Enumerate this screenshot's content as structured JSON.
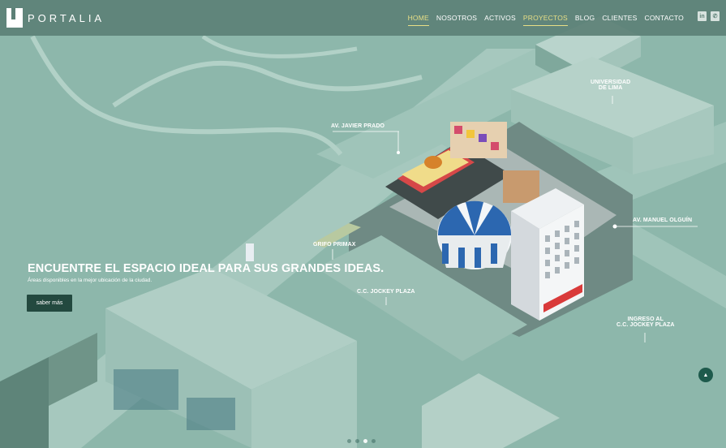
{
  "brand": {
    "name": "PORTALIA"
  },
  "nav": {
    "items": [
      {
        "label": "HOME",
        "state": "active"
      },
      {
        "label": "NOSOTROS",
        "state": ""
      },
      {
        "label": "ACTIVOS",
        "state": ""
      },
      {
        "label": "PROYECTOS",
        "state": "active"
      },
      {
        "label": "BLOG",
        "state": ""
      },
      {
        "label": "CLIENTES",
        "state": ""
      },
      {
        "label": "CONTACTO",
        "state": ""
      }
    ],
    "active_color": "#e8df86"
  },
  "social": {
    "linkedin": "in",
    "phone": "✆"
  },
  "hero": {
    "title": "ENCUENTRE EL ESPACIO IDEAL PARA SUS GRANDES IDEAS.",
    "subtitle": "Áreas disponibles en la mejor ubicación de la ciudad.",
    "cta_label": "saber más"
  },
  "map_labels": {
    "universidad": "UNIVERSIDAD\nDE LIMA",
    "javier_prado": "AV. JAVIER PRADO",
    "manuel_olguin": "AV. MANUEL OLGUÍN",
    "grifo": "GRIFO PRIMAX",
    "jockey": "C.C. JOCKEY PLAZA",
    "ingreso": "INGRESO AL\nC.C. JOCKEY PLAZA"
  },
  "slider": {
    "count": 4,
    "active_index": 2
  },
  "scroll_top_icon": "chevron-up-icon",
  "colors": {
    "teal_bg": "#8fb8ad",
    "header": "#5c8076",
    "cta": "#23493f"
  }
}
